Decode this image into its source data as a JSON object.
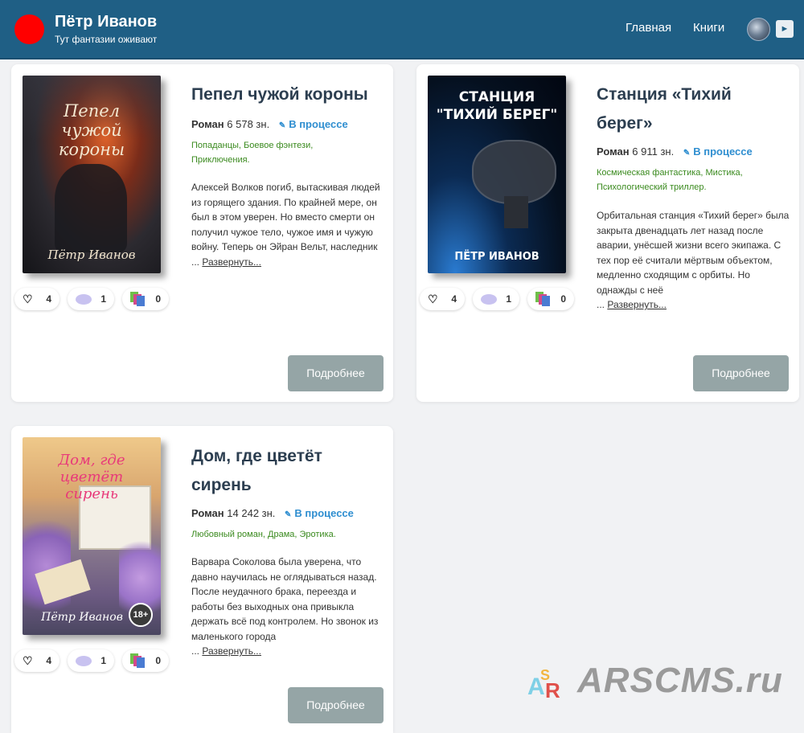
{
  "header": {
    "title": "Пётр Иванов",
    "subtitle": "Тут фантазии оживают",
    "nav": {
      "home": "Главная",
      "books": "Книги"
    },
    "play_icon": "►",
    "brand_color": "#1f5f85",
    "logo_color": "#ff0000"
  },
  "books": [
    {
      "title": "Пепел чужой короны",
      "cover_title": "Пепел чужой короны",
      "cover_author": "Пётр Иванов",
      "type": "Роман",
      "size": "6 578 зн.",
      "status": "В процессе",
      "tags": "Попаданцы, Боевое фэнтези, Приключения.",
      "description": "Алексей Волков погиб, вытаскивая людей из горящего здания. По крайней мере, он был в этом уверен. Но вместо смерти он получил чужое тело, чужое имя и чужую войну. Теперь он Эйран Вельт, наследник",
      "ellipsis": "...",
      "expand": "Развернуть...",
      "likes": "4",
      "comments": "1",
      "library": "0",
      "more": "Подробнее"
    },
    {
      "title": "Станция «Тихий берег»",
      "cover_title": "СТАНЦИЯ \"ТИХИЙ БЕРЕГ\"",
      "cover_author": "ПЁТР ИВАНОВ",
      "type": "Роман",
      "size": "6 911 зн.",
      "status": "В процессе",
      "tags": "Космическая фантастика, Мистика, Психологический триллер.",
      "description": "Орбитальная станция «Тихий берег» была закрыта двенадцать лет назад после аварии, унёсшей жизни всего экипажа. С тех пор её считали мёртвым объектом, медленно сходящим с орбиты. Но однажды с неё",
      "ellipsis": "...",
      "expand": "Развернуть...",
      "likes": "4",
      "comments": "1",
      "library": "0",
      "more": "Подробнее"
    },
    {
      "title": "Дом, где цветёт сирень",
      "cover_title": "Дом, где цветёт сирень",
      "cover_author": "Пётр Иванов",
      "cover_badge": "18+",
      "type": "Роман",
      "size": "14 242 зн.",
      "status": "В процессе",
      "tags": "Любовный роман, Драма, Эротика.",
      "description": "Варвара Соколова была уверена, что давно научилась не оглядываться назад. После неудачного брака, переезда и работы без выходных она привыкла держать всё под контролем. Но звонок из маленького города",
      "ellipsis": "...",
      "expand": "Развернуть...",
      "likes": "4",
      "comments": "1",
      "library": "0",
      "more": "Подробнее"
    }
  ],
  "watermark": {
    "text": "ARSCMS.ru"
  },
  "icons": {
    "like": "heart-icon",
    "comment": "comment-bubble-icon",
    "library": "books-icon",
    "status": "pen-icon"
  }
}
